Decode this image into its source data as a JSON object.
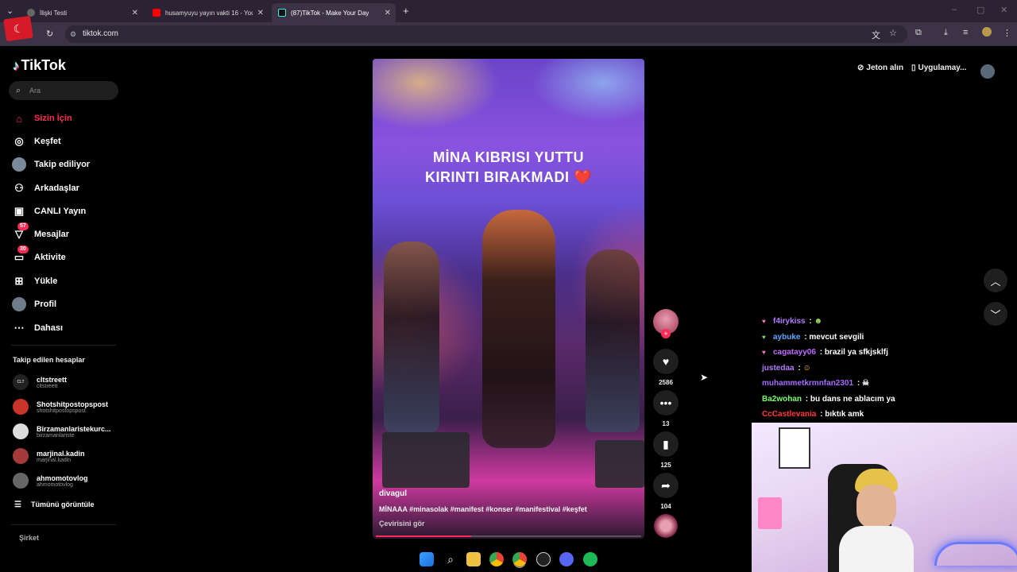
{
  "browser": {
    "tabs": [
      {
        "label": "İlişki Testi",
        "active": false
      },
      {
        "label": "husamyuyu yayın vakti 16 - You",
        "active": false
      },
      {
        "label": "(87)TikTok - Make Your Day",
        "active": true
      }
    ],
    "url": "tiktok.com"
  },
  "sidebar": {
    "logo": "TikTok",
    "search_placeholder": "Ara",
    "nav": [
      {
        "label": "Sizin İçin",
        "icon": "home-icon",
        "active": true
      },
      {
        "label": "Keşfet",
        "icon": "compass-icon"
      },
      {
        "label": "Takip ediliyor",
        "icon": "avatar-icon"
      },
      {
        "label": "Arkadaşlar",
        "icon": "friends-icon"
      },
      {
        "label": "CANLI Yayın",
        "icon": "live-icon"
      },
      {
        "label": "Mesajlar",
        "icon": "message-icon",
        "badge": "57"
      },
      {
        "label": "Aktivite",
        "icon": "activity-icon",
        "badge": "30"
      },
      {
        "label": "Yükle",
        "icon": "upload-icon"
      },
      {
        "label": "Profil",
        "icon": "profile-icon"
      },
      {
        "label": "Dahası",
        "icon": "more-icon"
      }
    ],
    "following_title": "Takip edilen hesaplar",
    "following": [
      {
        "name": "cltstreett",
        "handle": "cltstreett"
      },
      {
        "name": "Shotshitpostopspost",
        "handle": "shotshitpostopspost"
      },
      {
        "name": "Birzamanlaristekurc...",
        "handle": "birzamanlariste"
      },
      {
        "name": "marjinal.kadin",
        "handle": "marjinal.kadin"
      },
      {
        "name": "ahmomotovlog",
        "handle": "ahmomotovlog"
      }
    ],
    "see_all": "Tümünü görüntüle",
    "company": "Şirket"
  },
  "video": {
    "overlay_line1": "MİNA KIBRISI YUTTU",
    "overlay_line2": "KIRINTI BIRAKMADI ❤️",
    "author": "divagul",
    "description": "MİNAAA #minasolak #manifest #konser #manifestival #keşfet",
    "translate": "Çevirisini gör",
    "progress": 0.36
  },
  "actions": {
    "likes": "2586",
    "comments": "13",
    "saves": "125",
    "shares": "104"
  },
  "topright": {
    "coins": "Jeton alın",
    "app": "Uygulamay..."
  },
  "chat": [
    {
      "user": "f4irykiss",
      "message": "",
      "color": "#b57bff",
      "icon": "♥"
    },
    {
      "user": "aybuke",
      "message": "mevcut sevgili",
      "color": "#5fa8ff",
      "icon": "♥"
    },
    {
      "user": "cagatayy06",
      "message": "brazil ya sfkjsklfj",
      "color": "#c06bff",
      "icon": "♥"
    },
    {
      "user": "justedaa",
      "message": "",
      "color": "#b57bff",
      "icon": ""
    },
    {
      "user": "muhammetkrmnfan2301",
      "message": "",
      "color": "#a66bff",
      "icon": ""
    },
    {
      "user": "Ba2wohan",
      "message": "bu dans ne ablacım ya",
      "color": "#7dff6b",
      "icon": ""
    },
    {
      "user": "CcCastlevania",
      "message": "bıktık amk",
      "color": "#ff3b3b",
      "icon": ""
    }
  ],
  "colors": {
    "accent": "#fe2c55",
    "sidebar_bg": "#000000",
    "chrome_bg": "#2b2233"
  }
}
